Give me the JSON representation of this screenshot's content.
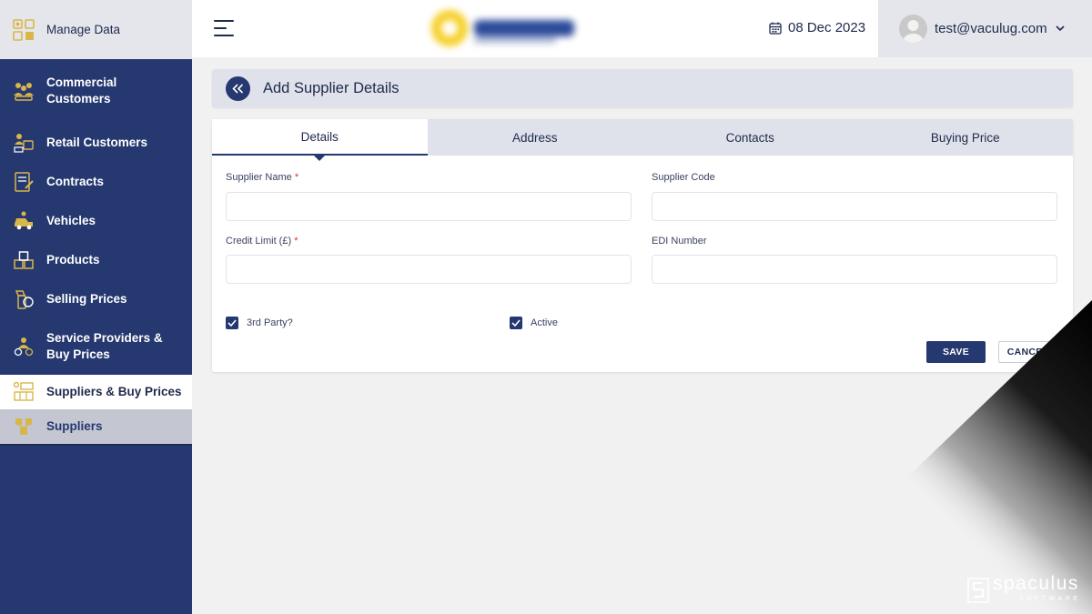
{
  "sidebar": {
    "header_label": "Manage Data",
    "items": [
      {
        "label": "Commercial Customers",
        "icon": "commercial-customers-icon"
      },
      {
        "label": "Retail Customers",
        "icon": "retail-customers-icon"
      },
      {
        "label": "Contracts",
        "icon": "contracts-icon"
      },
      {
        "label": "Vehicles",
        "icon": "vehicles-icon"
      },
      {
        "label": "Products",
        "icon": "products-icon"
      },
      {
        "label": "Selling Prices",
        "icon": "selling-prices-icon"
      },
      {
        "label": "Service Providers & Buy Prices",
        "icon": "service-providers-icon"
      },
      {
        "label": "Suppliers & Buy Prices",
        "icon": "suppliers-buy-prices-icon"
      },
      {
        "label": "Suppliers",
        "icon": "suppliers-icon"
      }
    ]
  },
  "topbar": {
    "date": "08 Dec 2023",
    "user_email": "test@vaculug.com"
  },
  "page": {
    "title": "Add Supplier Details"
  },
  "tabs": [
    {
      "label": "Details"
    },
    {
      "label": "Address"
    },
    {
      "label": "Contacts"
    },
    {
      "label": "Buying Price"
    }
  ],
  "form": {
    "supplier_name_label": "Supplier Name",
    "supplier_code_label": "Supplier Code",
    "credit_limit_label": "Credit Limit (£)",
    "edi_number_label": "EDI Number",
    "required_mark": "*",
    "supplier_name_value": "",
    "supplier_code_value": "",
    "credit_limit_value": "",
    "edi_number_value": "",
    "third_party_label": "3rd Party?",
    "third_party_checked": true,
    "active_label": "Active",
    "active_checked": true,
    "save_label": "SAVE",
    "cancel_label": "CANCEL"
  },
  "watermark": {
    "brand": "spaculus",
    "tagline": "SOFTWARE"
  },
  "colors": {
    "primary": "#25386f",
    "sidebar_icon": "#d9b64a",
    "required": "#d9302c",
    "panel": "#dfe2ea"
  }
}
